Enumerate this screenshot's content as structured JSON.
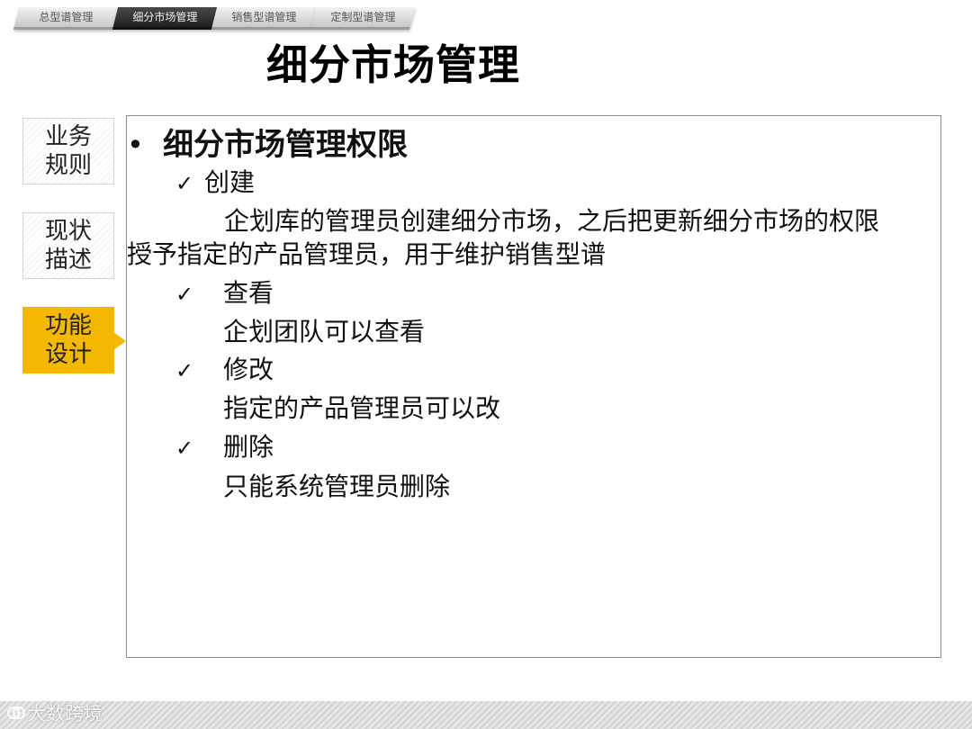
{
  "tabs": [
    {
      "label": "总型谱管理",
      "active": false
    },
    {
      "label": "细分市场管理",
      "active": true
    },
    {
      "label": "销售型谱管理",
      "active": false
    },
    {
      "label": "定制型谱管理",
      "active": false
    }
  ],
  "title": "细分市场管理",
  "side_nav": [
    {
      "label": "业务\n规则",
      "active": false
    },
    {
      "label": "现状\n描述",
      "active": false
    },
    {
      "label": "功能\n设计",
      "active": true
    }
  ],
  "content": {
    "bullet": "•",
    "heading": "细分市场管理权限",
    "check_mark": "✓",
    "items": [
      {
        "title": "创建",
        "desc_line1": "企划库的管理员创建细分市场，之后把更新细分市场的权限",
        "desc_line2": "授予指定的产品管理员，用于维护销售型谱"
      },
      {
        "title": "查看",
        "desc": "企划团队可以查看"
      },
      {
        "title": "修改",
        "desc": "指定的产品管理员可以改"
      },
      {
        "title": "删除",
        "desc": "只能系统管理员删除"
      }
    ]
  },
  "watermark": "大数跨境",
  "colors": {
    "accent": "#f5b800",
    "active_tab": "#2a2a2a"
  }
}
